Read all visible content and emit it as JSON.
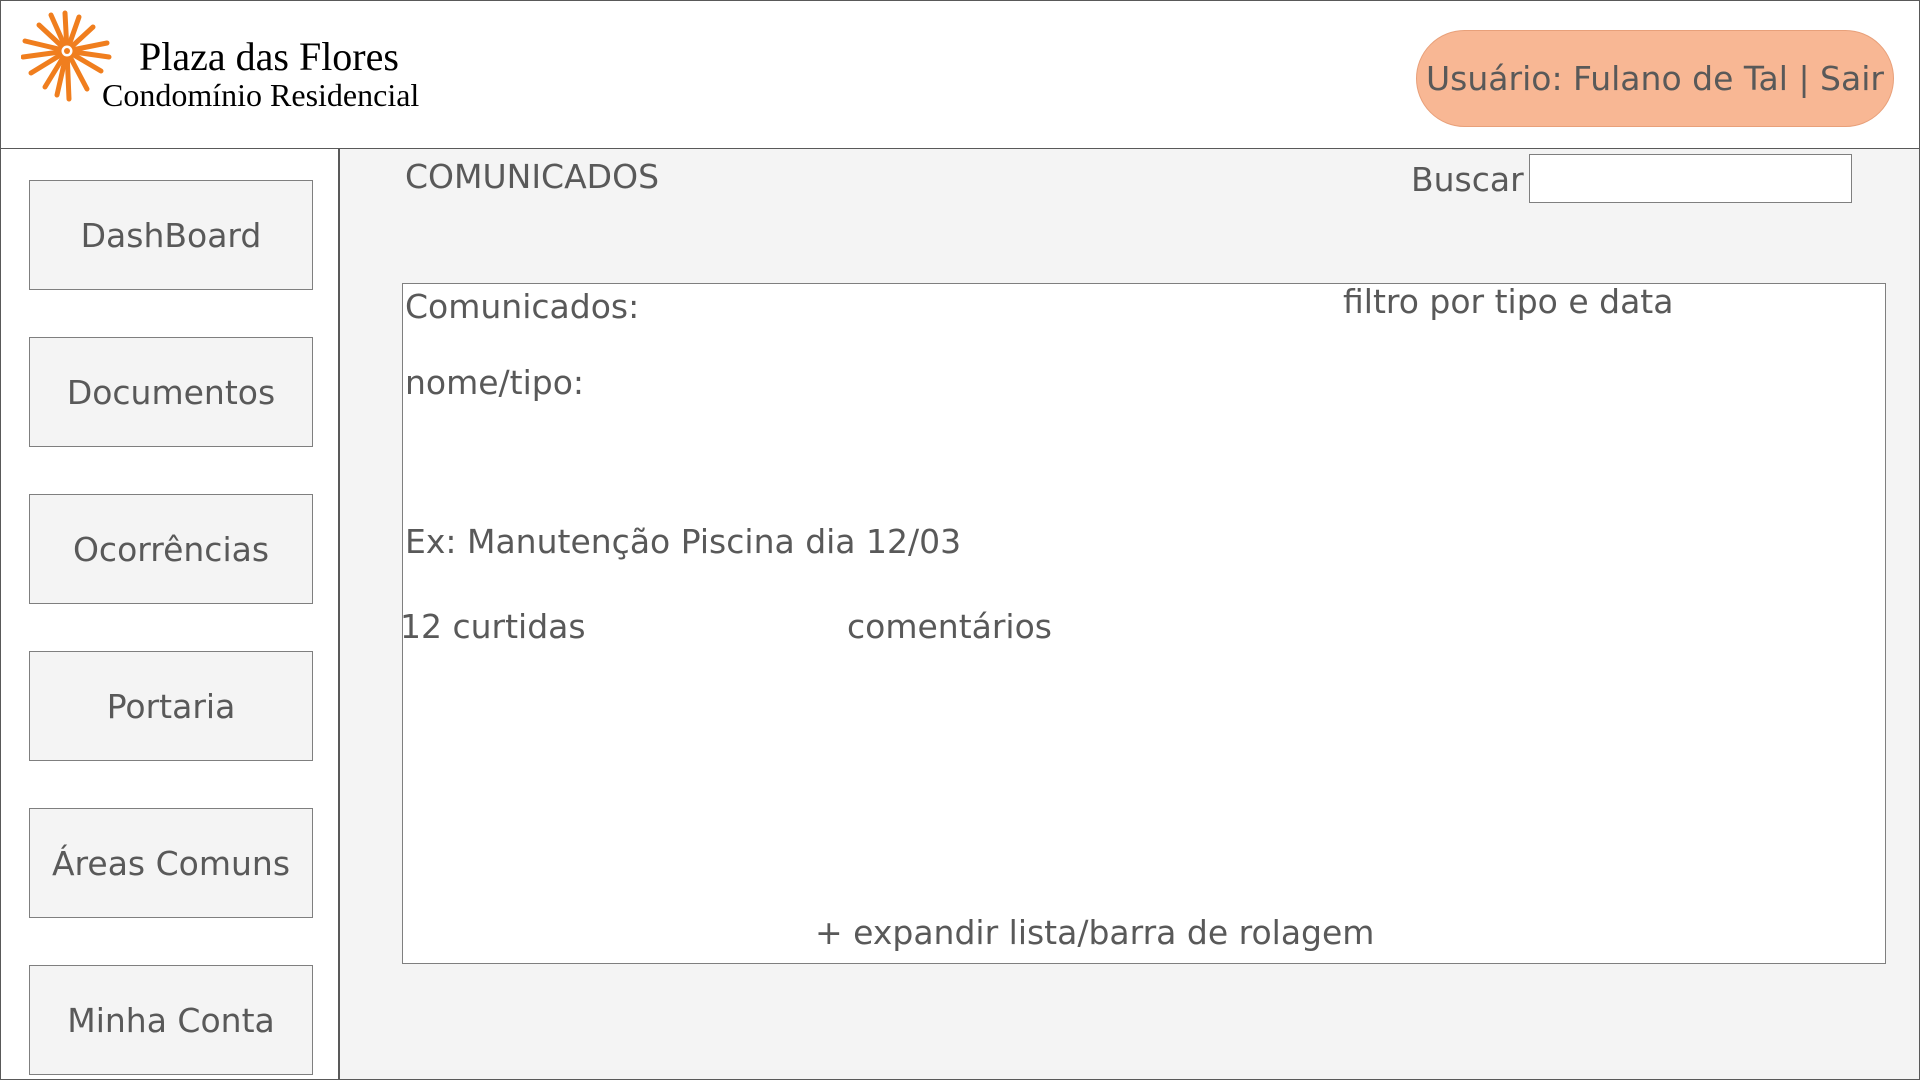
{
  "header": {
    "logo_name": "Plaza das Flores",
    "logo_subtitle": "Condomínio Residencial",
    "user_label": "Usuário: Fulano de Tal | Sair"
  },
  "sidebar": {
    "items": [
      {
        "label": "DashBoard"
      },
      {
        "label": "Documentos"
      },
      {
        "label": "Ocorrências"
      },
      {
        "label": "Portaria"
      },
      {
        "label": "Áreas Comuns"
      },
      {
        "label": "Minha Conta"
      }
    ]
  },
  "main": {
    "title": "COMUNICADOS",
    "search_label": "Buscar",
    "search_value": "",
    "panel": {
      "heading": "Comunicados:",
      "filter_label": "filtro por tipo e data",
      "name_type_label": "nome/tipo:",
      "example_item": "Ex: Manutenção Piscina dia 12/03",
      "likes": "12 curtidas",
      "comments": "comentários",
      "expand_label": "+ expandir lista/barra de rolagem"
    }
  },
  "colors": {
    "accent": "#f8b794",
    "logo_orange": "#f07e1e",
    "text_gray": "#595959",
    "main_bg": "#f4f4f4"
  },
  "icons": {
    "logo": "orange-flower-icon"
  }
}
